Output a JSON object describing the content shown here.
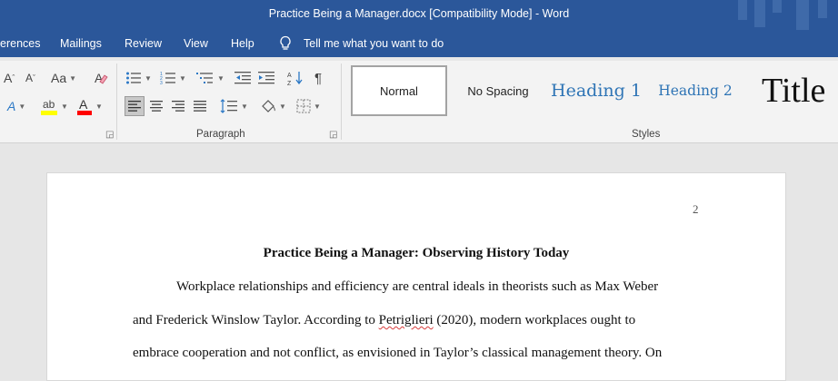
{
  "window": {
    "title": "Practice Being a Manager.docx [Compatibility Mode]  -  Word"
  },
  "menu": {
    "items": [
      "erences",
      "Mailings",
      "Review",
      "View",
      "Help"
    ],
    "tell_me": "Tell me what you want to do"
  },
  "ribbon": {
    "paragraph_label": "Paragraph",
    "styles_label": "Styles",
    "font_case": "Aa",
    "grow_font": "A",
    "shrink_font": "A",
    "text_effects": "A",
    "font_color": "A",
    "styles": {
      "normal": "Normal",
      "no_spacing": "No Spacing",
      "heading1": "Heading 1",
      "heading2": "Heading 2",
      "title": "Title"
    }
  },
  "colors": {
    "titlebar": "#2b579a",
    "heading": "#2e74b5",
    "highlight": "#ffff00",
    "font_color": "#ff0000"
  },
  "document": {
    "page_number": "2",
    "title": "Practice Being a Manager: Observing History Today",
    "line1": "Workplace relationships and efficiency are central ideals in theorists such as Max Weber",
    "line2_a": "and Frederick Winslow Taylor. According to ",
    "line2_b": "Petriglieri",
    "line2_c": " (2020), modern workplaces ought to",
    "line3": "embrace cooperation and not conflict, as envisioned in Taylor’s classical management theory. On"
  }
}
